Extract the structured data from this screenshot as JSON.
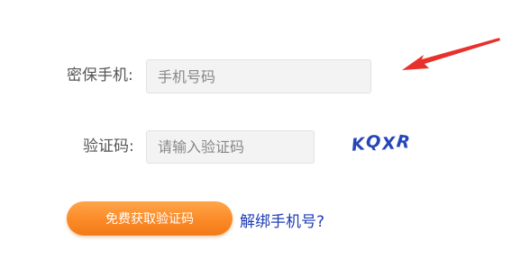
{
  "form": {
    "phone_label": "密保手机:",
    "phone_placeholder": "手机号码",
    "phone_value": "",
    "code_label": "验证码:",
    "code_placeholder": "请输入验证码",
    "code_value": "",
    "captcha_chars": [
      "K",
      "Q",
      "X",
      "R"
    ],
    "send_code_button": "免费获取验证码",
    "unbind_link": "解绑手机号?"
  },
  "colors": {
    "accent_orange": "#fb8a26",
    "link_blue": "#1f3cb5",
    "captcha_blue": "#2546b8",
    "arrow_red": "#e8312a"
  },
  "icons": {
    "pointer_arrow": "red-arrow-icon"
  }
}
